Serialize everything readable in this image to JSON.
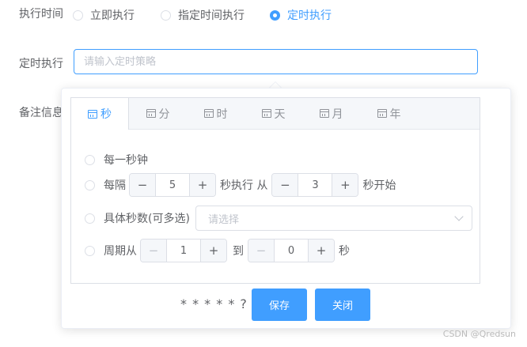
{
  "form": {
    "exec_time_label": "执行时间",
    "exec_options": [
      {
        "label": "立即执行",
        "selected": false
      },
      {
        "label": "指定时间执行",
        "selected": false
      },
      {
        "label": "定时执行",
        "selected": true
      }
    ],
    "schedule_label": "定时执行",
    "schedule_placeholder": "请输入定时策略",
    "remark_label": "备注信息"
  },
  "cron_panel": {
    "tabs": [
      {
        "label": "秒",
        "active": true
      },
      {
        "label": "分",
        "active": false
      },
      {
        "label": "时",
        "active": false
      },
      {
        "label": "天",
        "active": false
      },
      {
        "label": "月",
        "active": false
      },
      {
        "label": "年",
        "active": false
      }
    ],
    "options": {
      "every": {
        "label": "每一秒钟"
      },
      "interval": {
        "prefix": "每隔",
        "middle": "秒执行 从",
        "suffix": "秒开始",
        "every_value": "5",
        "start_value": "3"
      },
      "specific": {
        "label": "具体秒数(可多选)",
        "placeholder": "请选择"
      },
      "cycle": {
        "prefix": "周期从",
        "middle": "到",
        "suffix": "秒",
        "from_value": "1",
        "to_value": "0"
      }
    },
    "cron_expression": "* * * * * ? *",
    "save_label": "保存",
    "close_label": "关闭"
  },
  "watermark": "CSDN @Qredsun",
  "colors": {
    "primary": "#409eff",
    "border": "#dcdfe6",
    "text": "#606266",
    "placeholder": "#c0c4cc"
  }
}
